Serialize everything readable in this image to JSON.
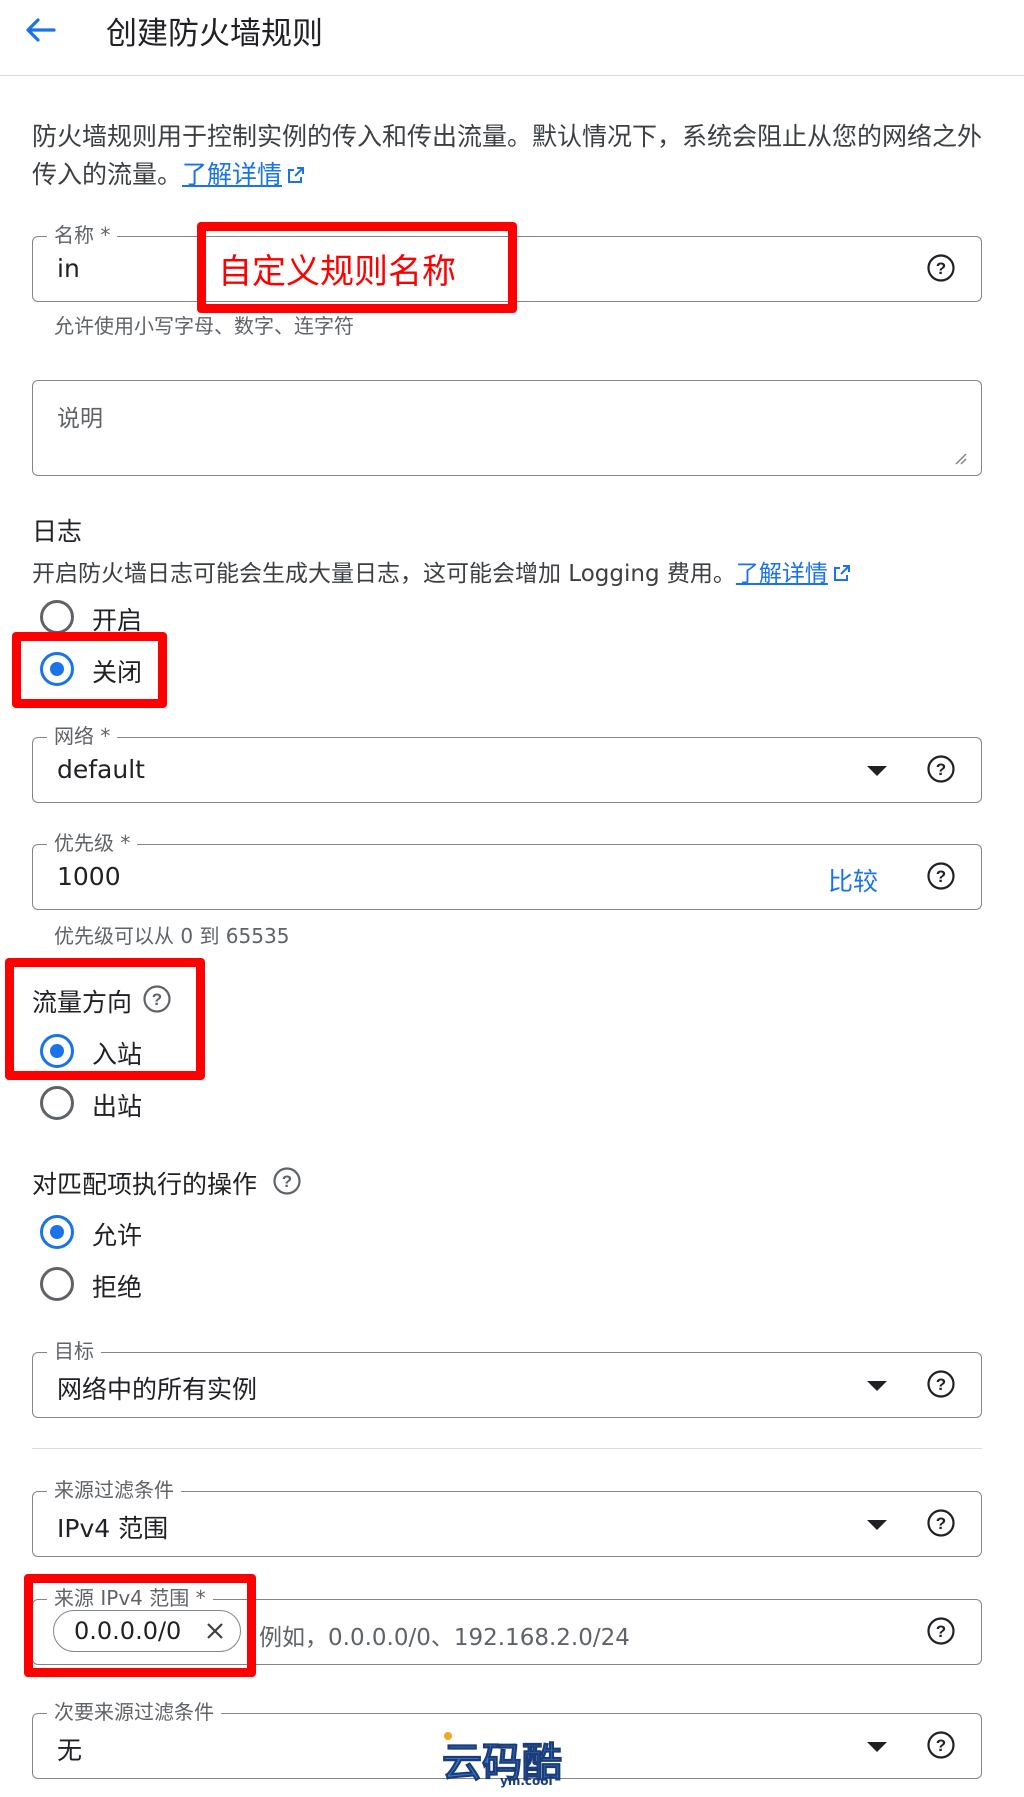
{
  "header": {
    "title": "创建防火墙规则"
  },
  "intro": {
    "text": "防火墙规则用于控制实例的传入和传出流量。默认情况下，系统会阻止从您的网络之外传入的流量。",
    "link": "了解详情"
  },
  "name_field": {
    "label": "名称 *",
    "value": "in",
    "hint": "允许使用小写字母、数字、连字符"
  },
  "annotation": {
    "name_note": "自定义规则名称"
  },
  "description_field": {
    "placeholder": "说明"
  },
  "logs": {
    "title": "日志",
    "desc": "开启防火墙日志可能会生成大量日志，这可能会增加 Logging 费用。",
    "link": "了解详情",
    "options": [
      "开启",
      "关闭"
    ],
    "selected": "关闭"
  },
  "network_field": {
    "label": "网络 *",
    "value": "default"
  },
  "priority_field": {
    "label": "优先级 *",
    "value": "1000",
    "compare": "比较",
    "hint": "优先级可以从 0 到 65535"
  },
  "direction": {
    "title": "流量方向",
    "options": [
      "入站",
      "出站"
    ],
    "selected": "入站"
  },
  "action": {
    "title": "对匹配项执行的操作",
    "options": [
      "允许",
      "拒绝"
    ],
    "selected": "允许"
  },
  "target_field": {
    "label": "目标",
    "value": "网络中的所有实例"
  },
  "source_filter_field": {
    "label": "来源过滤条件",
    "value": "IPv4 范围"
  },
  "source_ip_field": {
    "label": "来源 IPv4 范围 *",
    "chip": "0.0.0.0/0",
    "placeholder": "例如，0.0.0.0/0、192.168.2.0/24"
  },
  "secondary_filter_field": {
    "label": "次要来源过滤条件",
    "value": "无"
  },
  "watermark": {
    "main": "云码酷",
    "sub": "ym.cool"
  },
  "colors": {
    "accent": "#1a73e8",
    "annotation_red": "#ff0000",
    "border": "#80868b"
  }
}
